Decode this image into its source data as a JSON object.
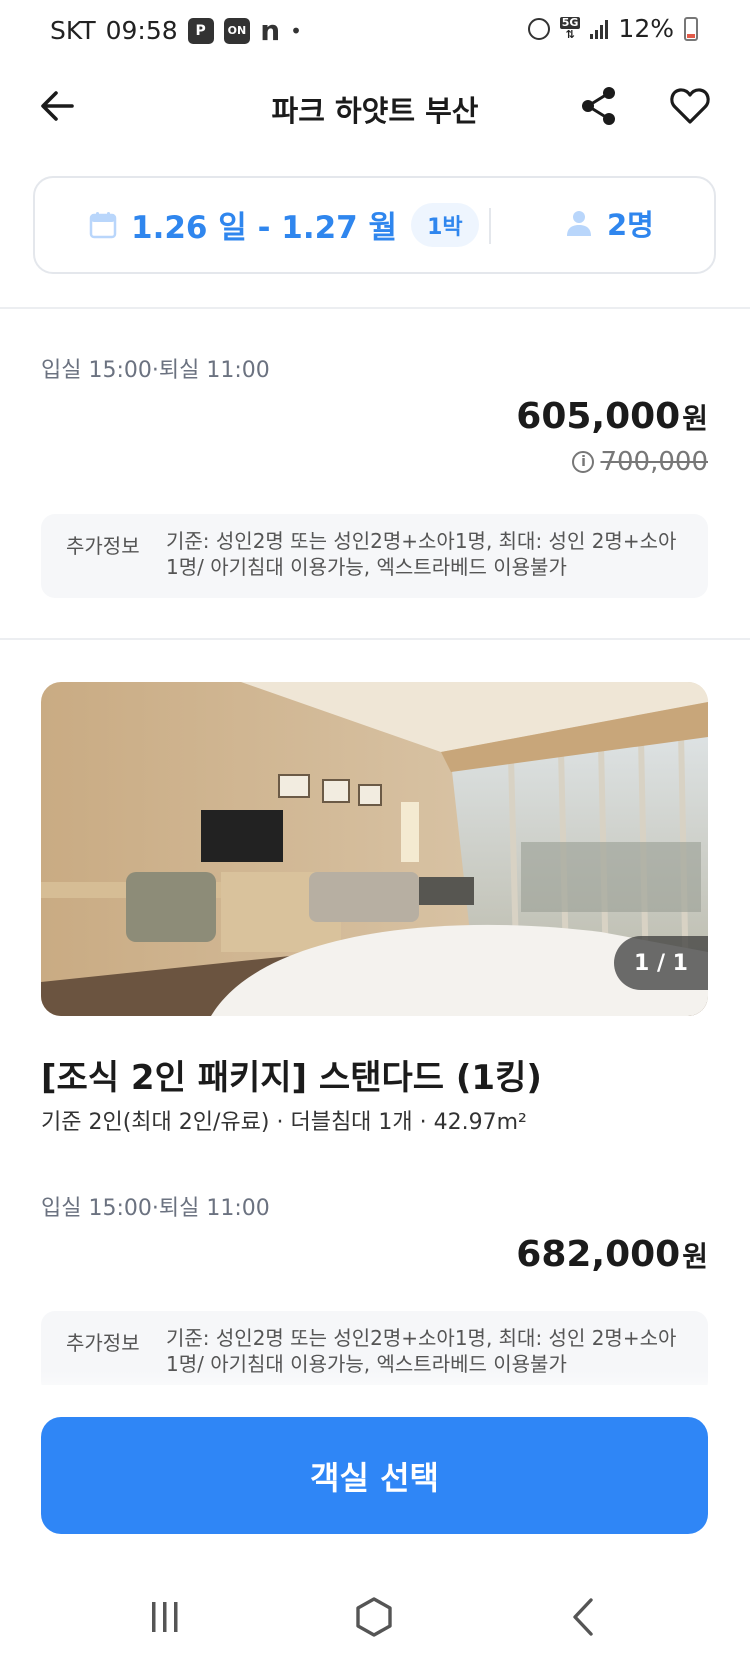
{
  "status_bar": {
    "carrier": "SKT",
    "time": "09:58",
    "badge_p": "P",
    "badge_on": "ON",
    "badge_n": "n",
    "network": "5G",
    "battery": "12%"
  },
  "header": {
    "title": "파크 하얏트 부산"
  },
  "booking_bar": {
    "dates": "1.26 일 - 1.27 월",
    "nights": "1박",
    "guests": "2명"
  },
  "room_1": {
    "checkin": "입실 15:00·퇴실 11:00",
    "price": "605,000",
    "price_unit": "원",
    "original_price": "700,000",
    "info_label": "추가정보",
    "info_text": "기준: 성인2명 또는 성인2명+소아1명, 최대: 성인 2명+소아1명/ 아기침대 이용가능, 엑스트라베드 이용불가"
  },
  "room_2": {
    "photo_counter": "1 / 1",
    "name": "[조식 2인 패키지] 스탠다드 (1킹)",
    "spec": "기준 2인(최대 2인/유료) · 더블침대 1개 · 42.97m²",
    "checkin": "입실 15:00·퇴실 11:00",
    "price": "682,000",
    "price_unit": "원",
    "info_label": "추가정보",
    "info_text": "기준: 성인2명 또는 성인2명+소아1명, 최대: 성인 2명+소아1명/ 아기침대 이용가능, 엑스트라베드 이용불가"
  },
  "cta": {
    "label": "객실 선택"
  },
  "colors": {
    "accent": "#2f86f6",
    "accent_text": "#2f86ee",
    "badge_bg": "#eef5fe",
    "info_bg": "#f6f7f9"
  },
  "icons": {
    "back": "arrow-left-icon",
    "share": "share-icon",
    "favorite": "heart-icon",
    "calendar": "calendar-icon",
    "guests": "person-icon",
    "info": "info-icon",
    "nav_recent": "recent-apps-icon",
    "nav_home": "home-icon",
    "nav_back": "back-chevron-icon"
  }
}
